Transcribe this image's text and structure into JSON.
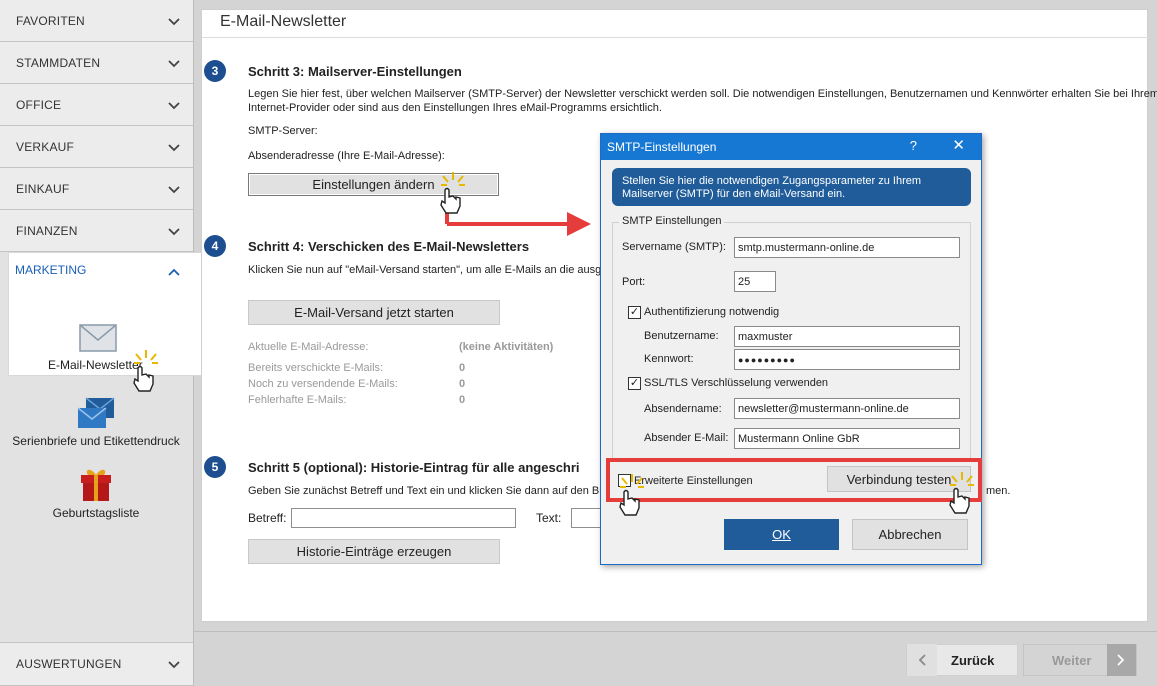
{
  "sidebar": {
    "items": [
      {
        "label": "FAVORITEN"
      },
      {
        "label": "STAMMDATEN"
      },
      {
        "label": "OFFICE"
      },
      {
        "label": "VERKAUF"
      },
      {
        "label": "EINKAUF"
      },
      {
        "label": "FINANZEN"
      }
    ],
    "open_section": {
      "label": "MARKETING"
    },
    "apps": [
      {
        "label": "E-Mail-Newsletter",
        "icon": "envelope-icon"
      },
      {
        "label": "Serienbriefe und Etikettendruck",
        "icon": "letters-icon"
      },
      {
        "label": "Geburtstagsliste",
        "icon": "gift-icon"
      }
    ],
    "bottom_item": {
      "label": "AUSWERTUNGEN"
    }
  },
  "main": {
    "title": "E-Mail-Newsletter",
    "step3": {
      "num": "3",
      "title": "Schritt 3: Mailserver-Einstellungen",
      "desc_line1": "Legen Sie hier fest, über welchen Mailserver (SMTP-Server) der Newsletter verschickt werden soll. Die notwendigen Einstellungen, Benutzernamen und Kennwörter erhalten Sie bei Ihrem",
      "desc_line2": "Internet-Provider oder sind aus den Einstellungen Ihres eMail-Programms ersichtlich.",
      "smtp_label": "SMTP-Server:",
      "sender_label": "Absenderadresse (Ihre E-Mail-Adresse):",
      "button": "Einstellungen ändern"
    },
    "step4": {
      "num": "4",
      "title": "Schritt 4: Verschicken des E-Mail-Newsletters",
      "desc": "Klicken Sie nun auf \"eMail-Versand starten\", um alle E-Mails an die ausgewä",
      "button": "E-Mail-Versand jetzt starten",
      "current_label": "Aktuelle E-Mail-Adresse:",
      "current_value": "(keine Aktivitäten)",
      "stats": [
        {
          "label": "Bereits verschickte E-Mails:",
          "value": "0"
        },
        {
          "label": "Noch zu versendende E-Mails:",
          "value": "0"
        },
        {
          "label": "Fehlerhafte E-Mails:",
          "value": "0"
        }
      ]
    },
    "step5": {
      "num": "5",
      "title": "Schritt 5 (optional): Historie-Eintrag für alle angeschri",
      "desc": "Geben Sie zunächst Betreff und Text ein und klicken Sie dann auf den Butt",
      "desc_tail": "men.",
      "subject_label": "Betreff:",
      "text_label": "Text:",
      "button": "Historie-Einträge erzeugen"
    }
  },
  "bottombar": {
    "back_label": "Zurück",
    "next_label": "Weiter"
  },
  "dialog": {
    "title": "SMTP-Einstellungen",
    "help": "?",
    "close": "✕",
    "info_line1": "Stellen Sie hier die notwendigen Zugangsparameter zu Ihrem",
    "info_line2": "Mailserver (SMTP) für den eMail-Versand ein.",
    "group_label": "SMTP Einstellungen",
    "server_label": "Servername (SMTP):",
    "server_value": "smtp.mustermann-online.de",
    "port_label": "Port:",
    "port_value": "25",
    "auth_label": "Authentifizierung notwendig",
    "user_label": "Benutzername:",
    "user_value": "maxmuster",
    "pass_label": "Kennwort:",
    "pass_value": "●●●●●●●●●",
    "ssl_label": "SSL/TLS Verschlüsselung verwenden",
    "sendername_label": "Absendername:",
    "sendername_value": "newsletter@mustermann-online.de",
    "sendermail_label": "Absender E-Mail:",
    "sendermail_value": "Mustermann Online GbR",
    "advanced_label": "Erweiterte Einstellungen",
    "test_button": "Verbindung testen",
    "ok_button": "OK",
    "cancel_button": "Abbrechen"
  },
  "colors": {
    "accent": "#1f5c99",
    "titlebar": "#1778d3",
    "highlight": "#e53c3c"
  }
}
